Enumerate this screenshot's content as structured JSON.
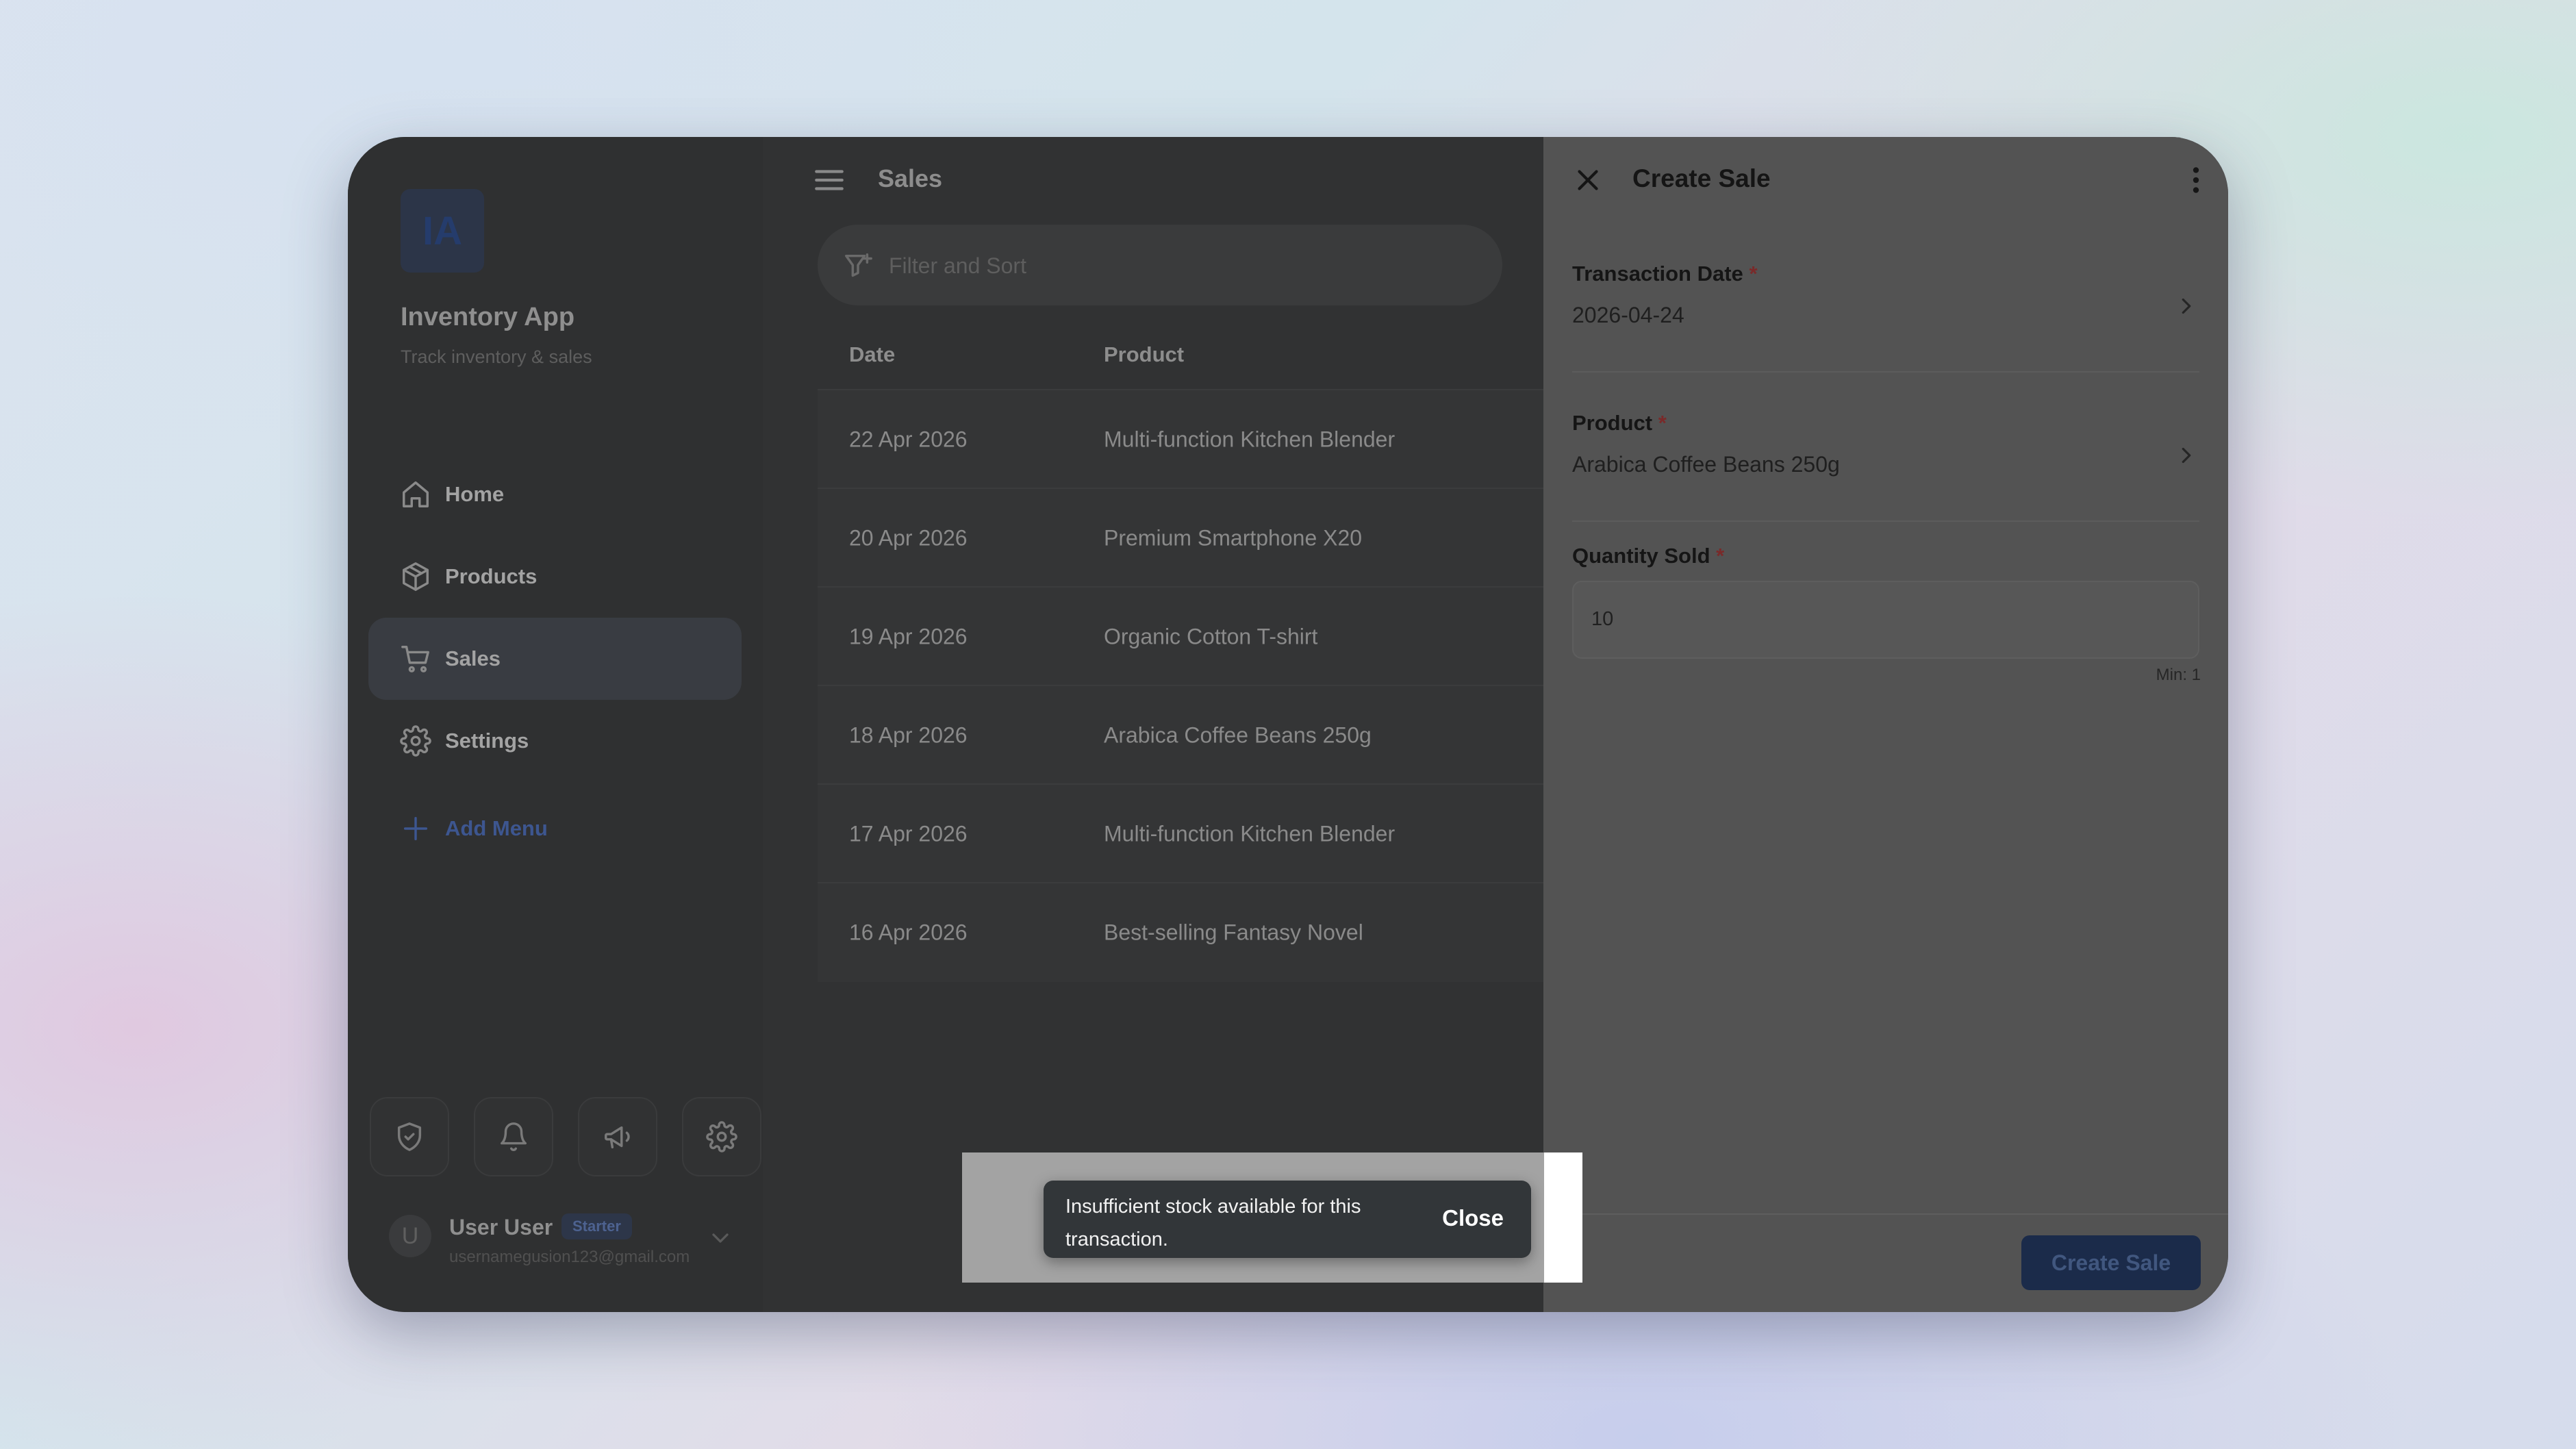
{
  "sidebar": {
    "logo": "IA",
    "app_name": "Inventory App",
    "tagline": "Track inventory & sales",
    "nav": [
      {
        "label": "Home",
        "icon": "home-icon"
      },
      {
        "label": "Products",
        "icon": "box-icon"
      },
      {
        "label": "Sales",
        "icon": "cart-icon",
        "active": true
      },
      {
        "label": "Settings",
        "icon": "gear-icon"
      }
    ],
    "add_menu": "Add Menu",
    "utility_icons": [
      "shield-check-icon",
      "bell-icon",
      "megaphone-icon",
      "gear-icon"
    ],
    "user": {
      "avatar_initial": "U",
      "name": "User User",
      "plan": "Starter",
      "email": "usernamegusion123@gmail.com"
    }
  },
  "main": {
    "title": "Sales",
    "search_placeholder": "Filter and Sort",
    "columns": [
      "Date",
      "Product"
    ],
    "rows": [
      {
        "date": "22 Apr 2026",
        "product": "Multi-function Kitchen Blender"
      },
      {
        "date": "20 Apr 2026",
        "product": "Premium Smartphone X20"
      },
      {
        "date": "19 Apr 2026",
        "product": "Organic Cotton T-shirt"
      },
      {
        "date": "18 Apr 2026",
        "product": "Arabica Coffee Beans 250g"
      },
      {
        "date": "17 Apr 2026",
        "product": "Multi-function Kitchen Blender"
      },
      {
        "date": "16 Apr 2026",
        "product": "Best-selling Fantasy Novel"
      }
    ]
  },
  "panel": {
    "title": "Create Sale",
    "fields": {
      "transaction_date": {
        "label": "Transaction Date",
        "required_mark": "*",
        "value": "2026-04-24"
      },
      "product": {
        "label": "Product",
        "required_mark": "*",
        "value": "Arabica Coffee Beans 250g"
      },
      "quantity": {
        "label": "Quantity Sold",
        "required_mark": "*",
        "value": "10",
        "hint": "Min: 1"
      }
    },
    "submit_label": "Create Sale"
  },
  "toast": {
    "message": "Insufficient stock available for this transaction.",
    "action": "Close"
  },
  "colors": {
    "accent": "#1b2b4a",
    "required": "#7a2a2a",
    "toast_bg": "#323639"
  }
}
